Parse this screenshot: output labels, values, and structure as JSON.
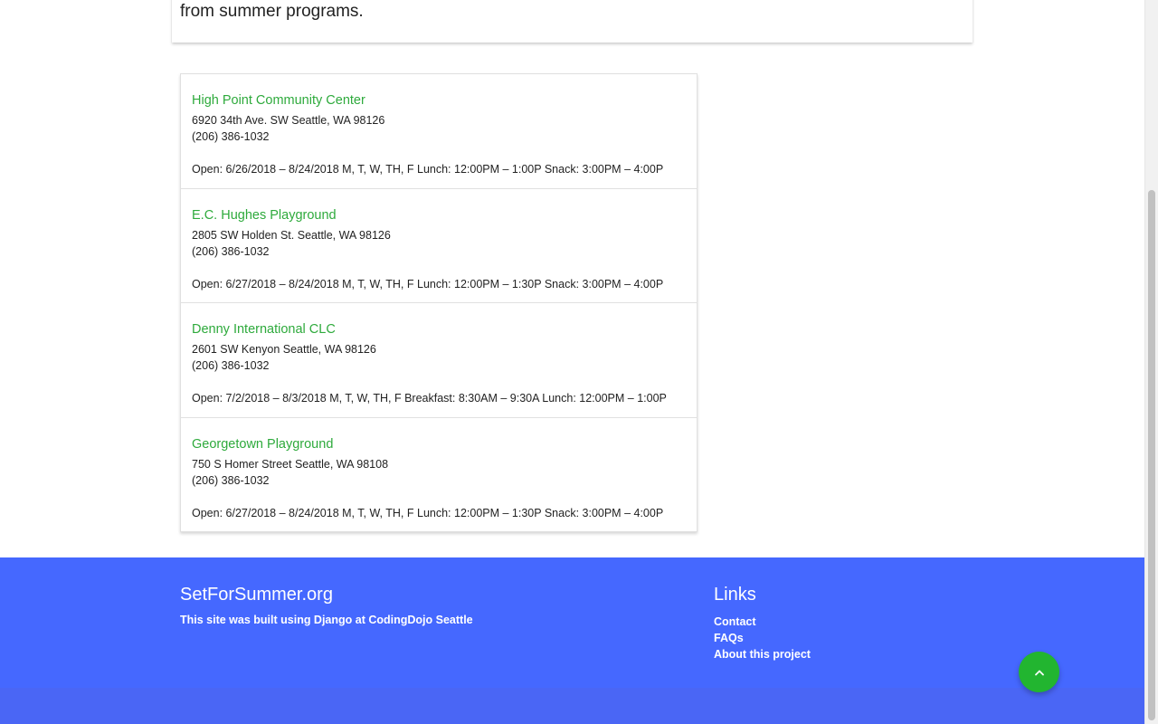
{
  "intro": {
    "text": "from summer programs."
  },
  "sites": [
    {
      "name": "High Point Community Center",
      "address": "6920 34th Ave. SW Seattle, WA 98126",
      "phone": "(206) 386-1032",
      "hours": "Open: 6/26/2018 – 8/24/2018 M, T, W, TH, F Lunch: 12:00PM – 1:00P Snack: 3:00PM – 4:00P"
    },
    {
      "name": "E.C. Hughes Playground",
      "address": "2805 SW Holden St. Seattle, WA 98126",
      "phone": "(206) 386-1032",
      "hours": "Open: 6/27/2018 – 8/24/2018 M, T, W, TH, F Lunch: 12:00PM – 1:30P Snack: 3:00PM – 4:00P"
    },
    {
      "name": "Denny International CLC",
      "address": "2601 SW Kenyon Seattle, WA 98126",
      "phone": "(206) 386-1032",
      "hours": "Open: 7/2/2018 – 8/3/2018 M, T, W, TH, F Breakfast: 8:30AM – 9:30A Lunch: 12:00PM – 1:00P"
    },
    {
      "name": "Georgetown Playground",
      "address": "750 S Homer Street Seattle, WA 98108",
      "phone": "(206) 386-1032",
      "hours": "Open: 6/27/2018 – 8/24/2018 M, T, W, TH, F Lunch: 12:00PM – 1:30P Snack: 3:00PM – 4:00P"
    }
  ],
  "footer": {
    "site_title": "SetForSummer.org",
    "built_with": "This site was built using Django at CodingDojo Seattle",
    "links_title": "Links",
    "links": [
      "Contact",
      "FAQs",
      "About this project"
    ]
  },
  "icons": {
    "back_to_top": "chevron-up-icon"
  },
  "colors": {
    "link_green": "#2eaa3c",
    "footer_blue": "#4568ff",
    "fab_green": "#22b530"
  }
}
